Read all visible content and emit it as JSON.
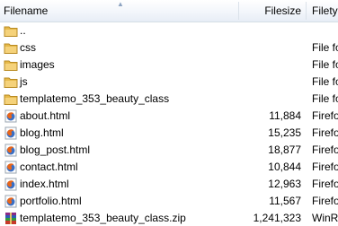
{
  "columns": {
    "filename": "Filename",
    "filesize": "Filesize",
    "filetype": "Filety"
  },
  "files": [
    {
      "name": "..",
      "size": "",
      "type": "",
      "icon": "folder-icon"
    },
    {
      "name": "css",
      "size": "",
      "type": "File fo",
      "icon": "folder-icon"
    },
    {
      "name": "images",
      "size": "",
      "type": "File fo",
      "icon": "folder-icon"
    },
    {
      "name": "js",
      "size": "",
      "type": "File fo",
      "icon": "folder-icon"
    },
    {
      "name": "templatemo_353_beauty_class",
      "size": "",
      "type": "File fo",
      "icon": "folder-icon"
    },
    {
      "name": "about.html",
      "size": "11,884",
      "type": "Firefo",
      "icon": "firefox-icon"
    },
    {
      "name": "blog.html",
      "size": "15,235",
      "type": "Firefo",
      "icon": "firefox-icon"
    },
    {
      "name": "blog_post.html",
      "size": "18,877",
      "type": "Firefo",
      "icon": "firefox-icon"
    },
    {
      "name": "contact.html",
      "size": "10,844",
      "type": "Firefo",
      "icon": "firefox-icon"
    },
    {
      "name": "index.html",
      "size": "12,963",
      "type": "Firefo",
      "icon": "firefox-icon"
    },
    {
      "name": "portfolio.html",
      "size": "11,567",
      "type": "Firefo",
      "icon": "firefox-icon"
    },
    {
      "name": "templatemo_353_beauty_class.zip",
      "size": "1,241,323",
      "type": "WinR",
      "icon": "winrar-archive-icon"
    }
  ]
}
